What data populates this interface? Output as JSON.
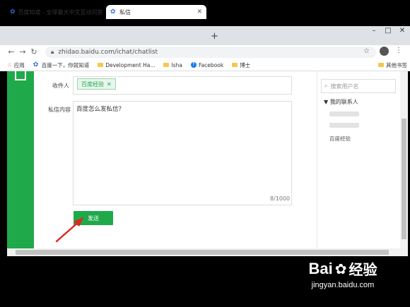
{
  "browser": {
    "tabs": [
      {
        "label": "百度知道 - 全球最大中文互动问答",
        "active": false
      },
      {
        "label": "私信",
        "active": true
      }
    ],
    "new_tab_symbol": "+",
    "window_controls": {
      "minimize": "–",
      "maximize": "□",
      "close": "✕"
    },
    "url": "zhidao.baidu.com/ichat/chatlist",
    "bookmarks": [
      {
        "icon": "apps-icon",
        "label": "应用"
      },
      {
        "icon": "paw-icon",
        "label": "百度一下，你就知道"
      },
      {
        "icon": "folder-icon",
        "label": "Development Ha..."
      },
      {
        "icon": "folder-icon",
        "label": "Isha"
      },
      {
        "icon": "facebook-icon",
        "label": "Facebook"
      },
      {
        "icon": "folder-icon",
        "label": "博士"
      }
    ],
    "other_bookmarks": "其他书签"
  },
  "form": {
    "recipient_label": "收件人",
    "recipient_tag": "百度经验",
    "message_label": "私信内容",
    "message_text": "百度怎么发私信？",
    "counter": "8/1000",
    "send_label": "发送"
  },
  "sidebar": {
    "search_placeholder": "搜索用户名",
    "contacts_title": "▼ 我的联系人",
    "contact_name": "百度经验"
  },
  "watermark": {
    "brand": "Bai",
    "brand2": "经验",
    "url": "jingyan.baidu.com"
  },
  "colors": {
    "accent": "#1fa94a",
    "background": "#000000"
  }
}
